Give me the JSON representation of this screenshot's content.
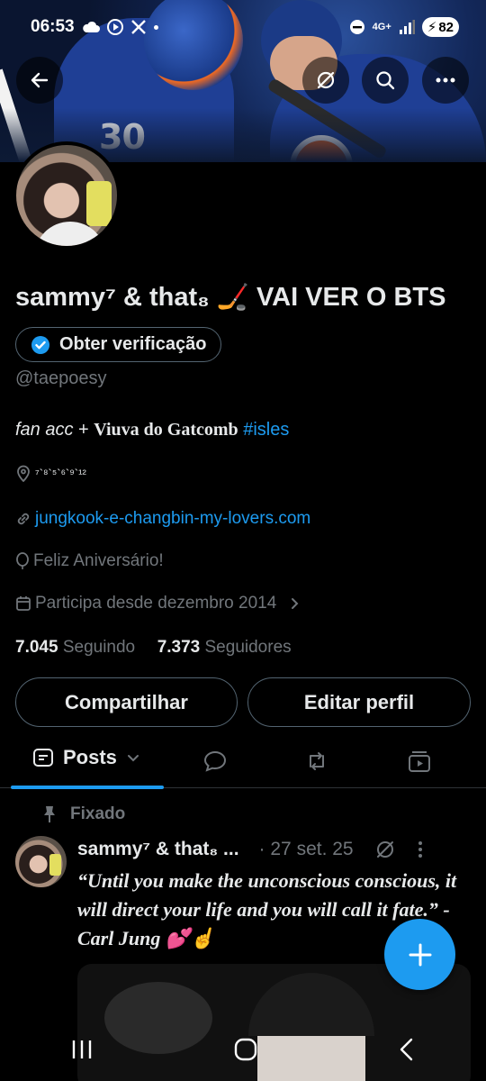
{
  "status_bar": {
    "time": "06:53",
    "network": "4G+",
    "battery": "82"
  },
  "banner": {
    "jersey_number": "30"
  },
  "profile": {
    "display_name": "sammy⁷ & that₈ 🏒 VAI VER O BTS",
    "verify_label": "Obter verificação",
    "handle": "@taepoesy",
    "bio": {
      "part1": "fan acc",
      "part2": " + ",
      "part3": "Viuva do Gatcomb",
      "hashtag": " #isles"
    },
    "location": "⁷`⁸`⁵`⁶`⁹`¹²",
    "website": "jungkook-e-changbin-my-lovers.com",
    "birthday": "Feliz Aniversário!",
    "joined": "Participa desde dezembro 2014",
    "following_count": "7.045",
    "following_label": " Seguindo",
    "followers_count": "7.373",
    "followers_label": " Seguidores"
  },
  "actions": {
    "share": "Compartilhar",
    "edit": "Editar perfil"
  },
  "tabs": {
    "posts": "Posts"
  },
  "post": {
    "pinned_label": "Fixado",
    "author": "sammy⁷ & that₈ ...",
    "date": "· 27 set. 25",
    "text": "“Until you make the unconscious conscious, it will direct your life and you will call it fate.” - Carl Jung 💕☝️"
  },
  "colors": {
    "accent": "#1d9bf0",
    "muted": "#71767b",
    "border": "#536471"
  }
}
